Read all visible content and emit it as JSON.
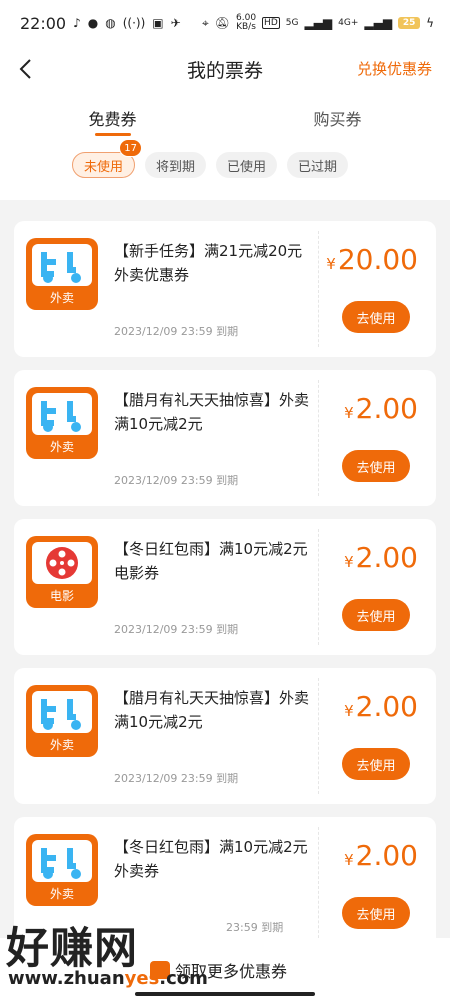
{
  "status_bar": {
    "time": "22:00",
    "network_speed_value": "6.00",
    "network_speed_unit": "KB/s",
    "hd": "HD",
    "signal_1": "5G",
    "signal_2": "4G+",
    "battery": "25"
  },
  "nav": {
    "title": "我的票券",
    "action_label": "兑换优惠券"
  },
  "tabs": [
    {
      "label": "免费券",
      "active": true
    },
    {
      "label": "购买券",
      "active": false
    }
  ],
  "filters": [
    {
      "label": "未使用",
      "active": true,
      "badge": "17"
    },
    {
      "label": "将到期",
      "active": false
    },
    {
      "label": "已使用",
      "active": false
    },
    {
      "label": "已过期",
      "active": false
    }
  ],
  "coupons": [
    {
      "icon": "scooter-icon",
      "icon_label": "外卖",
      "title": "【新手任务】满21元减20元外卖优惠券",
      "currency": "¥",
      "amount": "20.00",
      "expiry": "2023/12/09 23:59 到期",
      "button": "去使用"
    },
    {
      "icon": "scooter-icon",
      "icon_label": "外卖",
      "title": "【腊月有礼天天抽惊喜】外卖满10元减2元",
      "currency": "¥",
      "amount": "2.00",
      "expiry": "2023/12/09 23:59 到期",
      "button": "去使用"
    },
    {
      "icon": "film-reel-icon",
      "icon_label": "电影",
      "title": "【冬日红包雨】满10元减2元电影券",
      "currency": "¥",
      "amount": "2.00",
      "expiry": "2023/12/09 23:59 到期",
      "button": "去使用"
    },
    {
      "icon": "scooter-icon",
      "icon_label": "外卖",
      "title": "【腊月有礼天天抽惊喜】外卖满10元减2元",
      "currency": "¥",
      "amount": "2.00",
      "expiry": "2023/12/09 23:59 到期",
      "button": "去使用"
    },
    {
      "icon": "scooter-icon",
      "icon_label": "外卖",
      "title": "【冬日红包雨】满10元减2元外卖券",
      "currency": "¥",
      "amount": "2.00",
      "expiry": "23:59 到期",
      "button": "去使用"
    }
  ],
  "footer": {
    "more_label": "领取更多优惠券"
  },
  "watermark": {
    "main": "好赚网",
    "sub_prefix": "www.zhuan",
    "sub_highlight": "yes",
    "sub_suffix": ".com"
  },
  "colors": {
    "accent": "#ef6a0a",
    "scooter": "#3ab4f2",
    "reel": "#e53935"
  }
}
